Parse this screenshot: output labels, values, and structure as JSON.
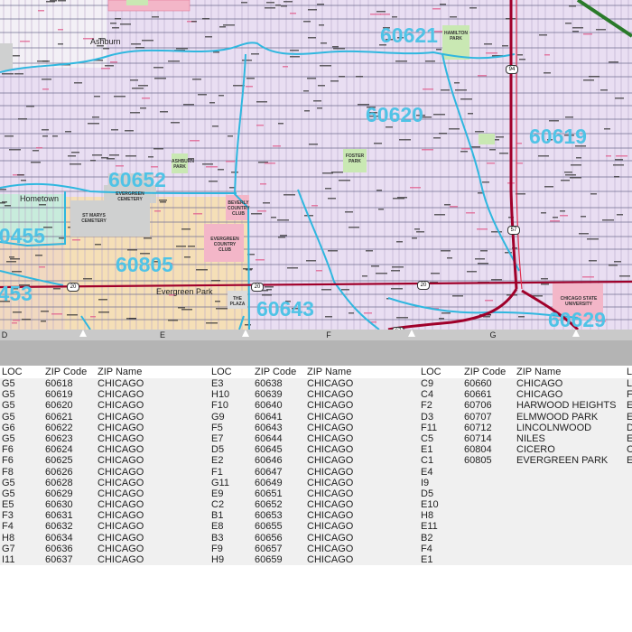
{
  "map": {
    "zip_labels": [
      "60621",
      "60620",
      "60619",
      "60652",
      "60455",
      "60805",
      "60643",
      "60629",
      "60453"
    ],
    "place_labels": [
      "Ashburn",
      "Evergreen Park",
      "Hometown"
    ],
    "park_labels": [
      "ST MARYS CEMETERY",
      "EVERGREEN CEMETERY",
      "BEVERLY COUNTRY CLUB",
      "EVERGREEN COUNTRY CLUB",
      "CHICAGO STATE UNIVERSITY",
      "THE PLAZA",
      "FOSTER PARK",
      "ASHBURN PARK",
      "HAMILTON PARK"
    ],
    "highway_shields": [
      "20",
      "20",
      "20",
      "67",
      "94",
      "57"
    ],
    "colors": {
      "residential": "#e9def2",
      "evergreen_park": "#f5dfb7",
      "hometown": "#c8ecdc",
      "zip_boundary": "#2fb7df",
      "highway": "#a0002a",
      "zip_label": "#4fc3e6",
      "park": "#c9e8b3",
      "cemetery": "#cfd0d0",
      "country_club": "#f3b6c8"
    }
  },
  "grid": {
    "columns": [
      "D",
      "E",
      "F",
      "G"
    ]
  },
  "legend": {
    "headers": {
      "loc": "LOC",
      "zip": "ZIP Code",
      "name": "ZIP Name"
    },
    "columns": [
      {
        "rows": [
          {
            "loc": "G5",
            "zip": "60618",
            "name": "CHICAGO"
          },
          {
            "loc": "G5",
            "zip": "60619",
            "name": "CHICAGO"
          },
          {
            "loc": "G5",
            "zip": "60620",
            "name": "CHICAGO"
          },
          {
            "loc": "G5",
            "zip": "60621",
            "name": "CHICAGO"
          },
          {
            "loc": "G6",
            "zip": "60622",
            "name": "CHICAGO"
          },
          {
            "loc": "G5",
            "zip": "60623",
            "name": "CHICAGO"
          },
          {
            "loc": "F6",
            "zip": "60624",
            "name": "CHICAGO"
          },
          {
            "loc": "F6",
            "zip": "60625",
            "name": "CHICAGO"
          },
          {
            "loc": "F8",
            "zip": "60626",
            "name": "CHICAGO"
          },
          {
            "loc": "G5",
            "zip": "60628",
            "name": "CHICAGO"
          },
          {
            "loc": "G5",
            "zip": "60629",
            "name": "CHICAGO"
          },
          {
            "loc": "E5",
            "zip": "60630",
            "name": "CHICAGO"
          },
          {
            "loc": "F3",
            "zip": "60631",
            "name": "CHICAGO"
          },
          {
            "loc": "F4",
            "zip": "60632",
            "name": "CHICAGO"
          },
          {
            "loc": "H8",
            "zip": "60634",
            "name": "CHICAGO"
          },
          {
            "loc": "G7",
            "zip": "60636",
            "name": "CHICAGO"
          },
          {
            "loc": "I11",
            "zip": "60637",
            "name": "CHICAGO"
          }
        ]
      },
      {
        "rows": [
          {
            "loc": "E3",
            "zip": "60638",
            "name": "CHICAGO"
          },
          {
            "loc": "H10",
            "zip": "60639",
            "name": "CHICAGO"
          },
          {
            "loc": "F10",
            "zip": "60640",
            "name": "CHICAGO"
          },
          {
            "loc": "G9",
            "zip": "60641",
            "name": "CHICAGO"
          },
          {
            "loc": "F5",
            "zip": "60643",
            "name": "CHICAGO"
          },
          {
            "loc": "E7",
            "zip": "60644",
            "name": "CHICAGO"
          },
          {
            "loc": "D5",
            "zip": "60645",
            "name": "CHICAGO"
          },
          {
            "loc": "E2",
            "zip": "60646",
            "name": "CHICAGO"
          },
          {
            "loc": "F1",
            "zip": "60647",
            "name": "CHICAGO"
          },
          {
            "loc": "G11",
            "zip": "60649",
            "name": "CHICAGO"
          },
          {
            "loc": "E9",
            "zip": "60651",
            "name": "CHICAGO"
          },
          {
            "loc": "C2",
            "zip": "60652",
            "name": "CHICAGO"
          },
          {
            "loc": "B1",
            "zip": "60653",
            "name": "CHICAGO"
          },
          {
            "loc": "E8",
            "zip": "60655",
            "name": "CHICAGO"
          },
          {
            "loc": "B3",
            "zip": "60656",
            "name": "CHICAGO"
          },
          {
            "loc": "F9",
            "zip": "60657",
            "name": "CHICAGO"
          },
          {
            "loc": "H9",
            "zip": "60659",
            "name": "CHICAGO"
          }
        ]
      },
      {
        "rows": [
          {
            "loc": "C9",
            "zip": "60660",
            "name": "CHICAGO"
          },
          {
            "loc": "C4",
            "zip": "60661",
            "name": "CHICAGO"
          },
          {
            "loc": "F2",
            "zip": "60706",
            "name": "HARWOOD HEIGHTS"
          },
          {
            "loc": "D3",
            "zip": "60707",
            "name": "ELMWOOD PARK"
          },
          {
            "loc": "F11",
            "zip": "60712",
            "name": "LINCOLNWOOD"
          },
          {
            "loc": "C5",
            "zip": "60714",
            "name": "NILES"
          },
          {
            "loc": "E1",
            "zip": "60804",
            "name": "CICERO"
          },
          {
            "loc": "C1",
            "zip": "60805",
            "name": "EVERGREEN PARK"
          },
          {
            "loc": "E4",
            "zip": "",
            "name": ""
          },
          {
            "loc": "I9",
            "zip": "",
            "name": ""
          },
          {
            "loc": "D5",
            "zip": "",
            "name": ""
          },
          {
            "loc": "E10",
            "zip": "",
            "name": ""
          },
          {
            "loc": "H8",
            "zip": "",
            "name": ""
          },
          {
            "loc": "E11",
            "zip": "",
            "name": ""
          },
          {
            "loc": "B2",
            "zip": "",
            "name": ""
          },
          {
            "loc": "F4",
            "zip": "",
            "name": ""
          },
          {
            "loc": "E1",
            "zip": "",
            "name": ""
          }
        ]
      }
    ],
    "fourth_column_loc_partial": [
      "L",
      "F",
      "E",
      "E",
      "D",
      "E",
      "C",
      "E"
    ]
  }
}
